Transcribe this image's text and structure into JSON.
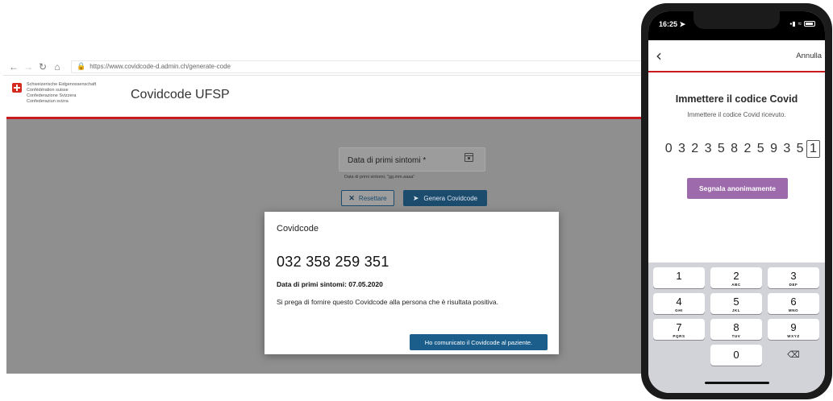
{
  "browser": {
    "url": "https://www.covidcode-d.admin.ch/generate-code",
    "confederation_lines": [
      "Schweizerische Eidgenossenschaft",
      "Confédération suisse",
      "Confederazione Svizzera",
      "Confederaziun svizra"
    ],
    "app_title": "Covidcode UFSP",
    "date_field_label": "Data di primi sintomi *",
    "date_hint": "Data di primi sintomi, \"gg.mm.aaaa\"",
    "reset_label": "Resettare",
    "generate_label": "Genera Covidcode",
    "colors": {
      "header_line": "#c91a1f",
      "primary_button": "#1b4b6d",
      "backdrop": "#8f8f8f"
    }
  },
  "modal": {
    "title": "Covidcode",
    "code": "032 358 259 351",
    "date_line": "Data di primi sintomi: 07.05.2020",
    "message": "Si prega di fornire questo Covidcode alla persona che è risultata positiva.",
    "confirm_label": "Ho comunicato il Covidcode al paziente."
  },
  "phone": {
    "status_time": "16:25",
    "cancel_label": "Annulla",
    "title": "Immettere il codice Covid",
    "subtitle": "Immettere il codice Covid ricevuto.",
    "digits": [
      "0",
      "3",
      "2",
      "3",
      "5",
      "8",
      "2",
      "5",
      "9",
      "3",
      "5",
      "1"
    ],
    "report_label": "Segnala anonimamente",
    "report_color": "#9d6aab",
    "keys": [
      {
        "n": "1",
        "l": ""
      },
      {
        "n": "2",
        "l": "ABC"
      },
      {
        "n": "3",
        "l": "DEF"
      },
      {
        "n": "4",
        "l": "GHI"
      },
      {
        "n": "5",
        "l": "JKL"
      },
      {
        "n": "6",
        "l": "MNO"
      },
      {
        "n": "7",
        "l": "PQRS"
      },
      {
        "n": "8",
        "l": "TUV"
      },
      {
        "n": "9",
        "l": "WXYZ"
      },
      {
        "n": "0",
        "l": ""
      }
    ],
    "delete_icon": "backspace-icon"
  }
}
